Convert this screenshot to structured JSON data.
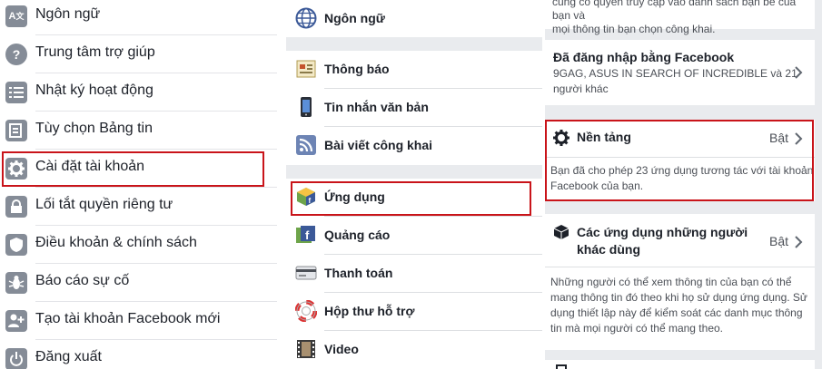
{
  "panel1": {
    "items": [
      {
        "label": "Ngôn ngữ",
        "icon": "language-icon"
      },
      {
        "label": "Trung tâm trợ giúp",
        "icon": "help-icon"
      },
      {
        "label": "Nhật ký hoạt động",
        "icon": "activity-log-icon"
      },
      {
        "label": "Tùy chọn Bảng tin",
        "icon": "news-feed-prefs-icon"
      },
      {
        "label": "Cài đặt tài khoản",
        "icon": "gear-icon"
      },
      {
        "label": "Lối tắt quyền riêng tư",
        "icon": "lock-icon"
      },
      {
        "label": "Điều khoản & chính sách",
        "icon": "shield-icon"
      },
      {
        "label": "Báo cáo sự cố",
        "icon": "bug-icon"
      },
      {
        "label": "Tạo tài khoản Facebook mới",
        "icon": "add-user-icon"
      },
      {
        "label": "Đăng xuất",
        "icon": "power-icon"
      }
    ]
  },
  "panel2": {
    "language": {
      "label": "Ngôn ngữ",
      "icon": "globe-icon"
    },
    "group1": [
      {
        "label": "Thông báo",
        "icon": "notification-icon"
      },
      {
        "label": "Tin nhắn văn bản",
        "icon": "phone-icon"
      },
      {
        "label": "Bài viết công khai",
        "icon": "rss-icon"
      }
    ],
    "group2": [
      {
        "label": "Ứng dụng",
        "icon": "apps-icon"
      },
      {
        "label": "Quảng cáo",
        "icon": "ads-icon"
      },
      {
        "label": "Thanh toán",
        "icon": "payment-icon"
      },
      {
        "label": "Hộp thư hỗ trợ",
        "icon": "lifebuoy-icon"
      },
      {
        "label": "Video",
        "icon": "video-icon"
      }
    ]
  },
  "panel3": {
    "intro_line1": "cũng có quyền truy cập vào danh sách bạn bè của bạn và",
    "intro_line2": "mọi thông tin bạn chọn công khai.",
    "fb_login": {
      "title": "Đã đăng nhập bằng Facebook",
      "subtitle_line1": "9GAG, ASUS IN SEARCH OF INCREDIBLE và 21",
      "subtitle_line2": "người khác"
    },
    "platform": {
      "title": "Nền tảng",
      "status": "Bật",
      "desc_line1": "Bạn đã cho phép 23 ứng dụng tương tác với tài khoản",
      "desc_line2": "Facebook của bạn."
    },
    "others_apps": {
      "title_line1": "Các ứng dụng những người",
      "title_line2": "khác dùng",
      "status": "Bật",
      "desc_line1": "Những người có thể xem thông tin của bạn có thể",
      "desc_line2": "mang thông tin đó theo khi họ sử dụng ứng dụng. Sử",
      "desc_line3": "dụng thiết lập này để kiểm soát các danh mục thông",
      "desc_line4": "tin mà mọi người có thể mang theo."
    }
  },
  "colors": {
    "highlight": "#c9141a",
    "grey_bg": "#e9ebee",
    "icon_grey": "#858c97",
    "text": "#1d2129",
    "subtext": "#4b4f56"
  }
}
